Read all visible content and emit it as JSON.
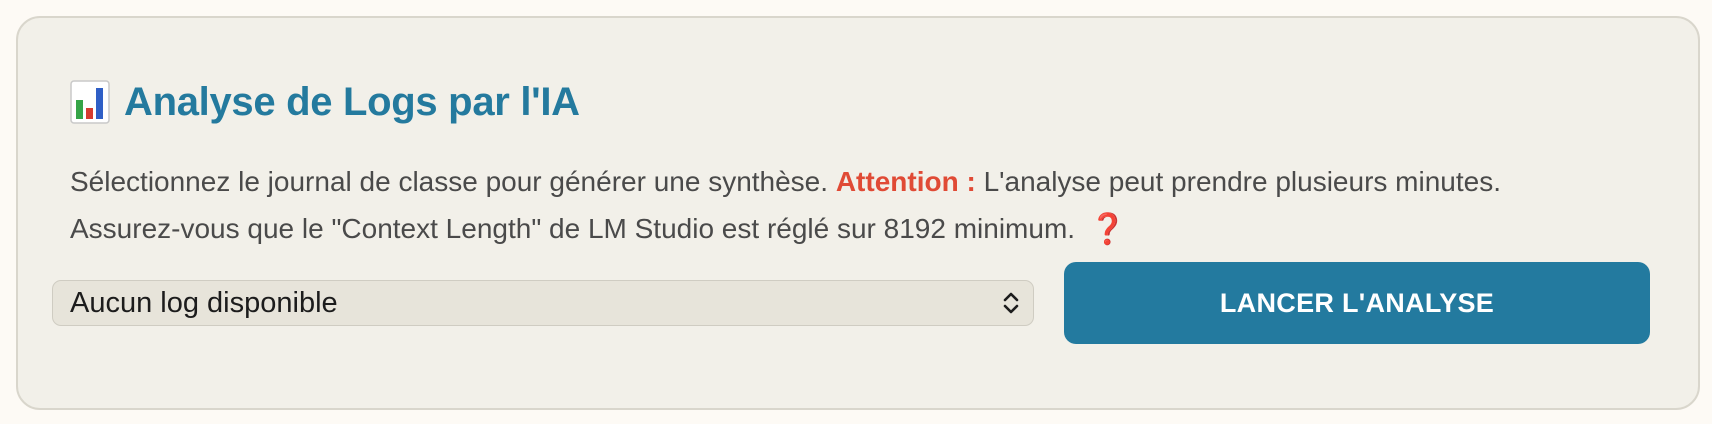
{
  "panel": {
    "title_icon": "bar-chart-icon",
    "title": "Analyse de Logs par l'IA",
    "description": {
      "line1_part1": "Sélectionnez le journal de classe pour générer une synthèse. ",
      "warning_label": "Attention :",
      "line1_part2": " L'analyse peut prendre plusieurs minutes.",
      "line2": "Assurez-vous que le \"Context Length\" de LM Studio est réglé sur 8192 minimum.",
      "help_icon": "❓"
    },
    "log_select": {
      "selected_value": "Aucun log disponible",
      "icon": "chevron-up-down-icon"
    },
    "run_button_label": "LANCER L'ANALYSE"
  },
  "colors": {
    "accent": "#237a9f",
    "warning": "#e04a35",
    "help": "#d22a22",
    "card_background": "#f2f0e9"
  }
}
